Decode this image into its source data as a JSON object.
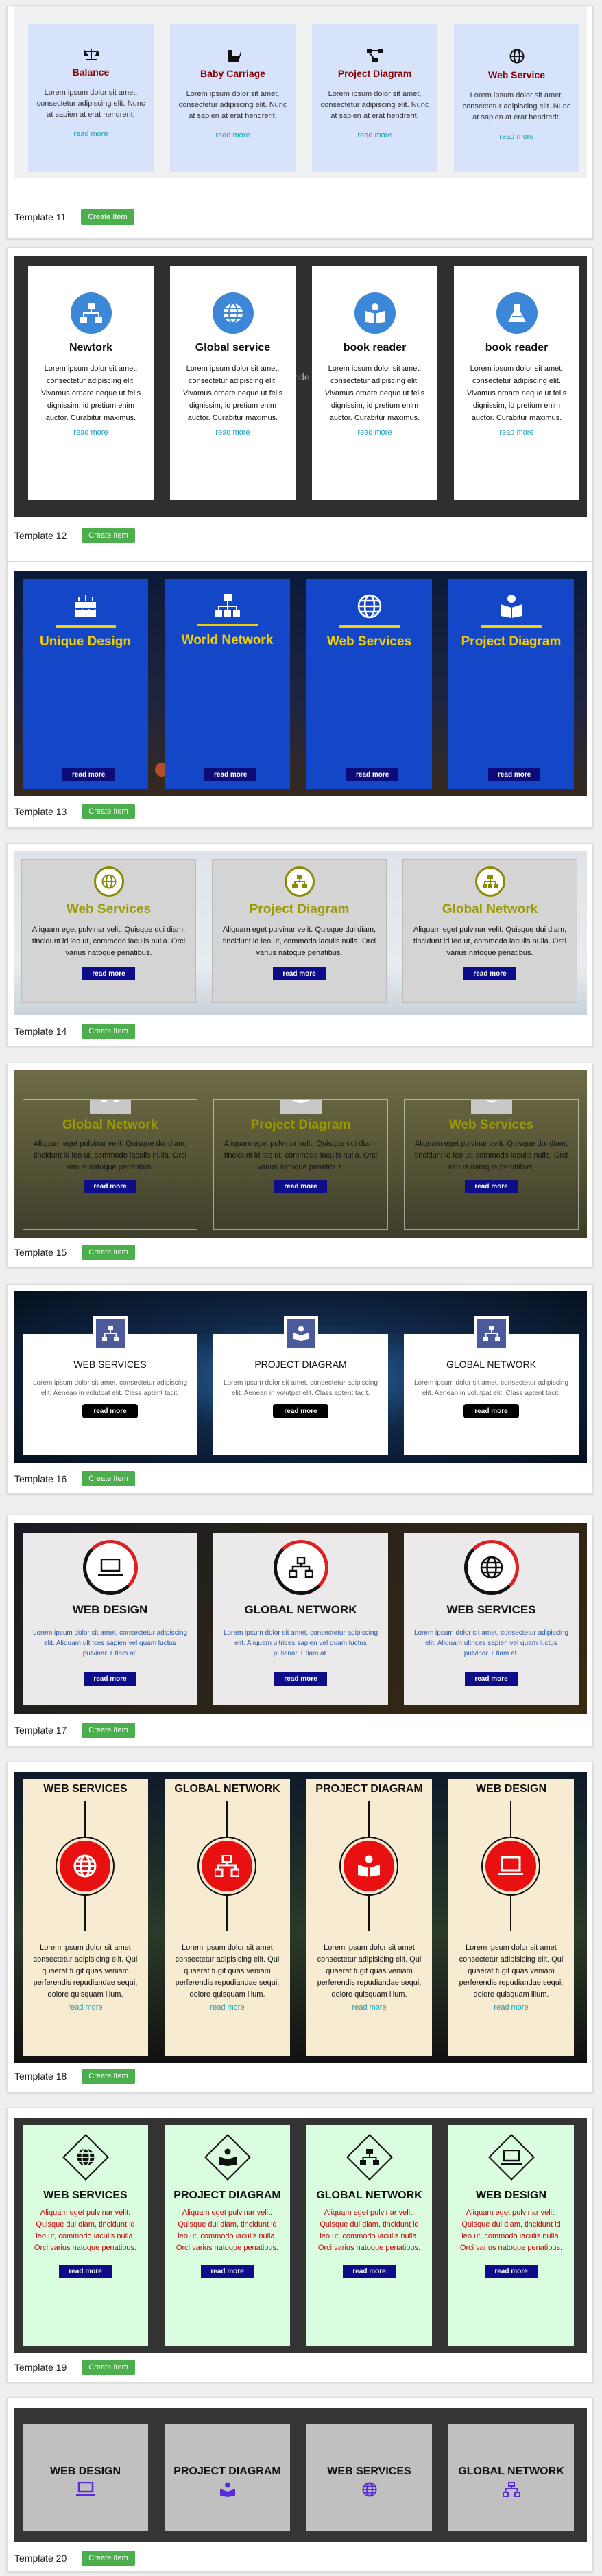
{
  "create_label": "Create Item",
  "lorem_short": "Lorem ipsum dolor sit amet, consectetur adipiscing elit. Nunc at sapien at erat hendrerit.",
  "lorem_tall": "Lorem ipsum dolor sit amet, consectetur adipiscing elit. Vivamus ornare neque ut felis dignissim, id pretium enim auctor. Curabitur maximus.",
  "lorem_aliquam": "Aliquam eget pulvinar velit. Quisque dui diam, tincidunt id leo ut, commodo iaculis nulla. Orci varius natoque penatibus.",
  "lorem_class": "Lorem ipsum dolor sit amet, consectetur adipiscing elit. Aenean in volutpat elit. Class aptent tacit.",
  "lorem_sapien": "Lorem ipsum dolor sit amet, consectetur adipiscing elit. Aliquam ultrices sapien vel quam luctus pulvinar. Etiam at.",
  "lorem_quisque": "Lorem ipsum dolor sit amet consectetur adipisicing elit. Qui quaerat fugit quas veniam perferendis repudiandae sequi, dolore quisquam illum.",
  "lorem_19": "Aliquam eget pulvinar velit. Quisque dui diam, tincidunt id leo ut, commodo iaculis nulla. Orci varius natoque penatibus.",
  "read_more": "read more",
  "t11": {
    "name": "Template 11",
    "cards": [
      "Balance",
      "Baby Carriage",
      "Project Diagram",
      "Web Service"
    ]
  },
  "t12": {
    "name": "Template 12",
    "cards": [
      "Newtork",
      "Global service",
      "book reader",
      "book reader"
    ],
    "watermark": "vide"
  },
  "t13": {
    "name": "Template 13",
    "cards": [
      "Unique Design",
      "World Network",
      "Web Services",
      "Project Diagram"
    ]
  },
  "t14": {
    "name": "Template 14",
    "cards": [
      "Web Services",
      "Project Diagram",
      "Global Network"
    ]
  },
  "t15": {
    "name": "Template 15",
    "cards": [
      "Global Network",
      "Project Diagram",
      "Web Services"
    ]
  },
  "t16": {
    "name": "Template 16",
    "cards": [
      "WEB SERVICES",
      "PROJECT DIAGRAM",
      "GLOBAL NETWORK"
    ]
  },
  "t17": {
    "name": "Template 17",
    "cards": [
      "WEB DESIGN",
      "GLOBAL NETWORK",
      "WEB SERVICES"
    ]
  },
  "t18": {
    "name": "Template 18",
    "cards": [
      "WEB SERVICES",
      "GLOBAL NETWORK",
      "PROJECT DIAGRAM",
      "WEB DESIGN"
    ]
  },
  "t19": {
    "name": "Template 19",
    "cards": [
      "WEB SERVICES",
      "PROJECT DIAGRAM",
      "GLOBAL NETWORK",
      "WEB DESIGN"
    ]
  },
  "t20": {
    "name": "Template 20",
    "cards": [
      "WEB DESIGN",
      "PROJECT DIAGRAM",
      "WEB SERVICES",
      "GLOBAL NETWORK"
    ]
  },
  "colors": {
    "green": "#4cae4c",
    "navy": "#0d0d8a",
    "blue13": "#1446c8",
    "red18": "#e81010"
  }
}
